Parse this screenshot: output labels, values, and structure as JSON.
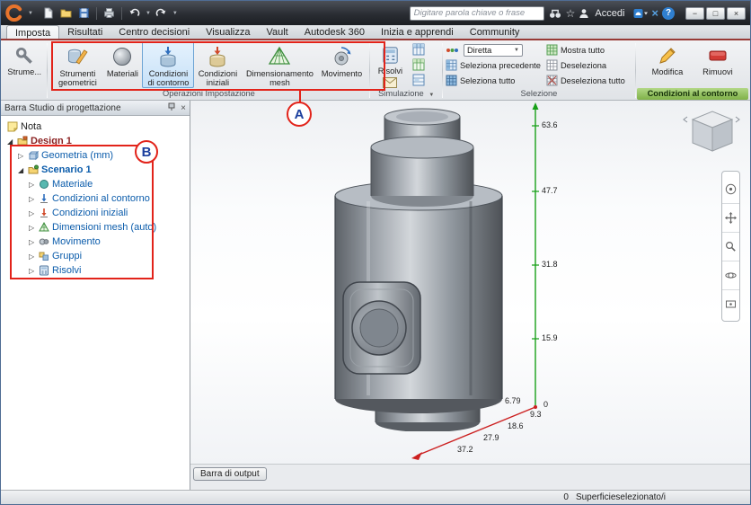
{
  "colors": {
    "annotation_red": "#e2231a",
    "annotation_letter_blue": "#1c3f9e",
    "ribbon_accent_maroon": "#973a36",
    "selected_button_blue": "#cfe4f8",
    "context_label_green": "#8cc63f",
    "tree_link_blue": "#0b5cab",
    "design_label_red": "#8a1f1f",
    "axis_green": "#18a018",
    "axis_red": "#cc2020"
  },
  "titlebar": {
    "search_placeholder": "Digitare parola chiave o frase",
    "signin_label": "Accedi"
  },
  "tabs": [
    "Imposta",
    "Risultati",
    "Centro decisioni",
    "Visualizza",
    "Vault",
    "Autodesk 360",
    "Inizia e apprendi",
    "Community"
  ],
  "ribbon": {
    "tools_label": "Strume...",
    "setup": {
      "title": "Operazioni Impostazione",
      "buttons": [
        "Strumenti geometrici",
        "Materiali",
        "Condizioni di contorno",
        "Condizioni iniziali",
        "Dimensionamento mesh",
        "Movimento"
      ]
    },
    "simulation": {
      "title": "Simulazione",
      "solve": "Risolvi"
    },
    "selection": {
      "title": "Selezione",
      "mode": "Diretta",
      "show_all": "Mostra tutto",
      "select_previous": "Seleziona precedente",
      "deselect": "Deseleziona",
      "select_all": "Seleziona tutto",
      "deselect_all": "Deseleziona tutto"
    },
    "context": {
      "title": "Condizioni al contorno",
      "edit": "Modifica",
      "remove": "Rimuovi"
    }
  },
  "browser": {
    "title": "Barra Studio di progettazione",
    "items": [
      {
        "label": "Nota"
      },
      {
        "label": "Design 1"
      },
      {
        "label": "Geometria  (mm)"
      },
      {
        "label": "Scenario 1"
      },
      {
        "label": "Materiale"
      },
      {
        "label": "Condizioni al contorno"
      },
      {
        "label": "Condizioni iniziali"
      },
      {
        "label": "Dimensioni mesh  (auto)"
      },
      {
        "label": "Movimento"
      },
      {
        "label": "Gruppi"
      },
      {
        "label": "Risolvi"
      }
    ]
  },
  "viewport": {
    "output_bar": "Barra di output",
    "y_axis": [
      "63.6",
      "47.7",
      "31.8",
      "15.9",
      "0"
    ],
    "x_axis": [
      "6.79",
      "9.3",
      "18.6",
      "27.9",
      "37.2"
    ]
  },
  "statusbar": {
    "count": "0",
    "text": "Superficieselezionato/i"
  },
  "annotations": {
    "a": "A",
    "b": "B"
  }
}
